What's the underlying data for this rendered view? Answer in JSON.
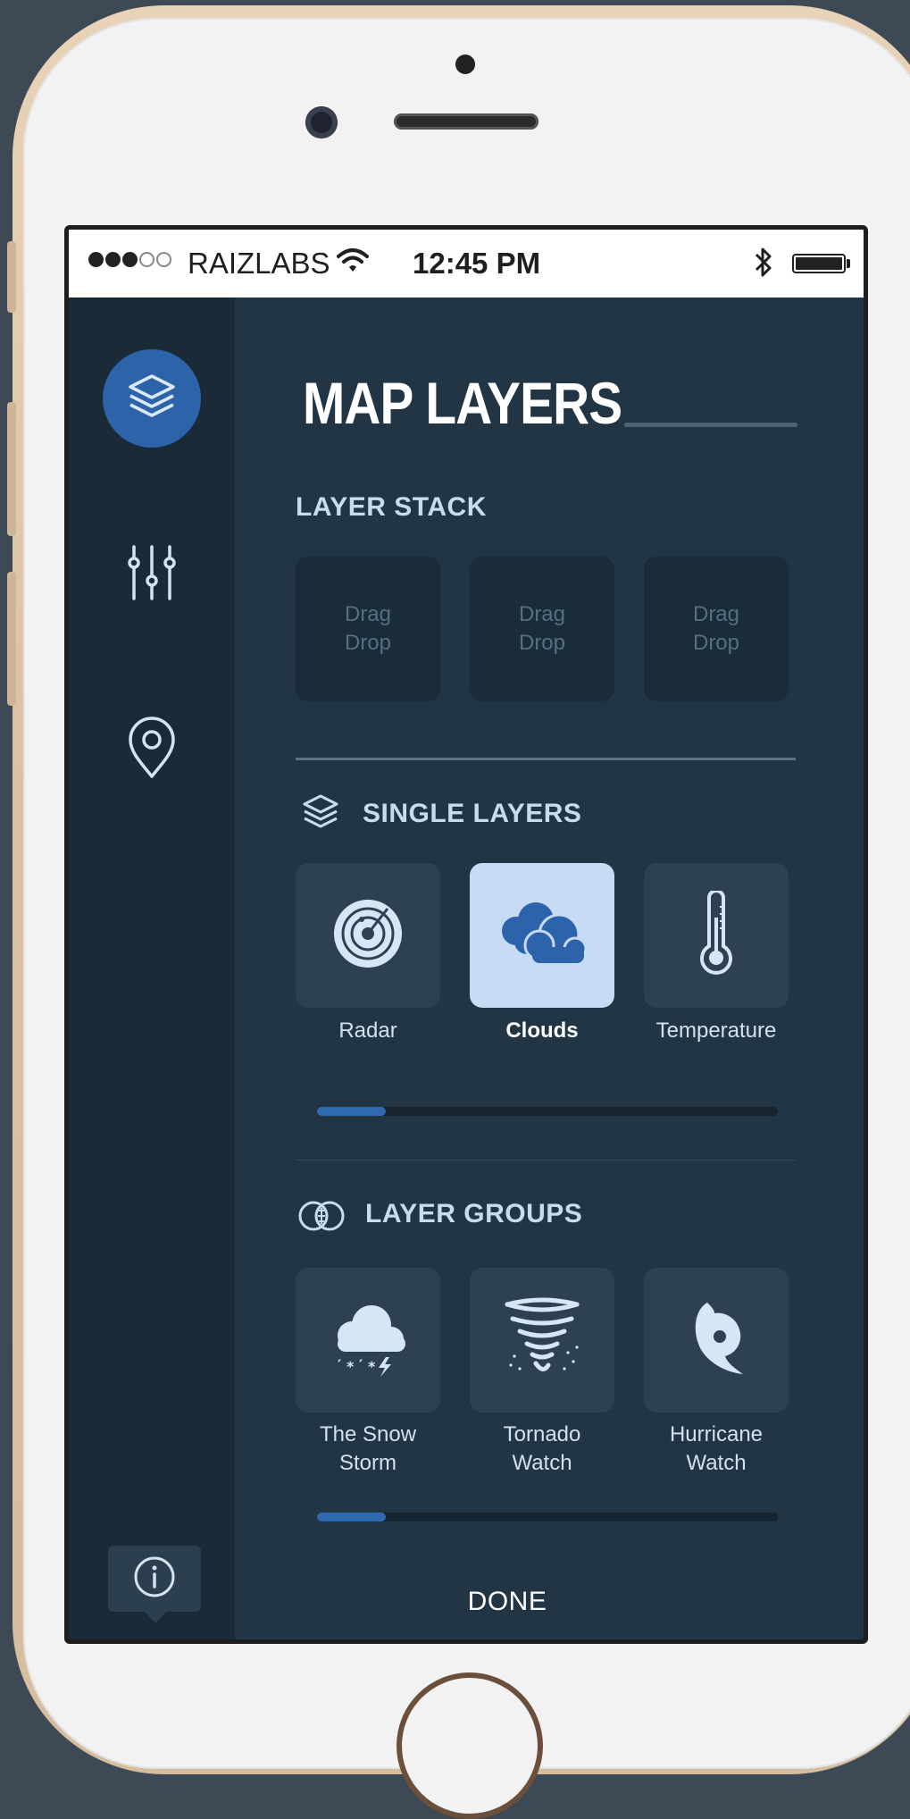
{
  "status_bar": {
    "carrier": "RAIZLABS",
    "time": "12:45 PM",
    "signal_bars_filled": 3,
    "signal_bars_total": 5
  },
  "sidebar": {
    "items": [
      {
        "name": "layers",
        "icon": "layers-icon",
        "active": true
      },
      {
        "name": "filters",
        "icon": "sliders-icon",
        "active": false
      },
      {
        "name": "location",
        "icon": "map-pin-icon",
        "active": false
      }
    ],
    "info_icon": "info-icon"
  },
  "header": {
    "title": "MAP LAYERS"
  },
  "layer_stack": {
    "label": "LAYER STACK",
    "slots": [
      {
        "line1": "Drag",
        "line2": "Drop"
      },
      {
        "line1": "Drag",
        "line2": "Drop"
      },
      {
        "line1": "Drag",
        "line2": "Drop"
      }
    ]
  },
  "single_layers": {
    "label": "SINGLE LAYERS",
    "icon": "layers-icon",
    "items": [
      {
        "label": "Radar",
        "icon": "radar-icon",
        "selected": false
      },
      {
        "label": "Clouds",
        "icon": "cloud-icon",
        "selected": true
      },
      {
        "label": "Temperature",
        "icon": "thermometer-icon",
        "selected": false
      }
    ],
    "scroll_position": 0.15
  },
  "layer_groups": {
    "label": "LAYER GROUPS",
    "icon": "venn-icon",
    "items": [
      {
        "line1": "The Snow",
        "line2": "Storm",
        "icon": "snowstorm-icon"
      },
      {
        "line1": "Tornado",
        "line2": "Watch",
        "icon": "tornado-icon"
      },
      {
        "line1": "Hurricane",
        "line2": "Watch",
        "icon": "hurricane-icon"
      }
    ],
    "scroll_position": 0.15
  },
  "footer": {
    "done_label": "DONE"
  },
  "colors": {
    "accent": "#2f6ab1",
    "panel_bg": "#223545",
    "sidebar_bg": "#1a2a37",
    "selected_tile": "#c7dcf4"
  }
}
